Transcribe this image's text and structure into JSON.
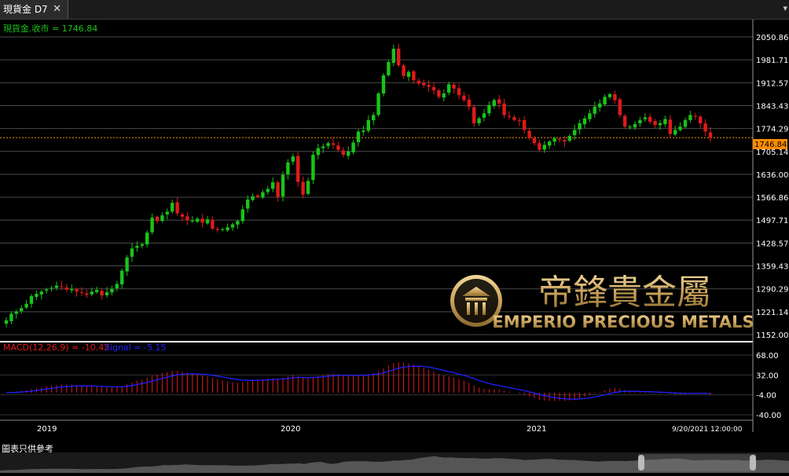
{
  "tab": {
    "title": "現貨金 D7",
    "close": "✕"
  },
  "menu_icon": "triangle-down-icon",
  "footer_note": "圖表只供參考",
  "colors": {
    "up": "#19c419",
    "down": "#e01a1a",
    "signal": "#2020ff",
    "price_line": "#ff8c00",
    "macd_hist": "#e01a1a"
  },
  "watermark": {
    "en": "EMPERIO PRECIOUS METALS",
    "zh": "帝鋒貴金屬"
  },
  "chart_data": [
    {
      "type": "candlestick",
      "label": "現貨金.收市 = 1746.84",
      "last_value": 1746.84,
      "last_label": "1746.84",
      "y_ticks": [
        "2050.86",
        "1981.71",
        "1912.57",
        "1843.43",
        "1774.29",
        "1705.14",
        "1636.00",
        "1566.86",
        "1497.71",
        "1428.57",
        "1359.43",
        "1290.29",
        "1221.14",
        "1152.00"
      ],
      "ylim": [
        1152.0,
        2050.86
      ],
      "x_tick_labels": [
        "2019",
        "2020",
        "2021"
      ],
      "x_date_label": "9/20/2021 12:00:00",
      "close_series": [
        1195,
        1215,
        1222,
        1232,
        1245,
        1268,
        1275,
        1282,
        1288,
        1293,
        1300,
        1296,
        1288,
        1290,
        1282,
        1278,
        1272,
        1282,
        1287,
        1270,
        1280,
        1290,
        1305,
        1345,
        1385,
        1412,
        1420,
        1425,
        1460,
        1505,
        1495,
        1512,
        1523,
        1550,
        1518,
        1508,
        1497,
        1496,
        1502,
        1490,
        1500,
        1472,
        1468,
        1470,
        1476,
        1485,
        1495,
        1530,
        1560,
        1570,
        1568,
        1582,
        1592,
        1612,
        1568,
        1635,
        1672,
        1690,
        1613,
        1575,
        1616,
        1695,
        1715,
        1720,
        1730,
        1725,
        1710,
        1695,
        1705,
        1732,
        1765,
        1768,
        1800,
        1815,
        1880,
        1935,
        1975,
        2015,
        1965,
        1933,
        1945,
        1920,
        1910,
        1905,
        1900,
        1890,
        1870,
        1880,
        1908,
        1895,
        1875,
        1860,
        1840,
        1790,
        1805,
        1820,
        1845,
        1860,
        1850,
        1815,
        1810,
        1800,
        1798,
        1770,
        1745,
        1730,
        1710,
        1725,
        1735,
        1745,
        1740,
        1735,
        1752,
        1770,
        1790,
        1805,
        1820,
        1840,
        1850,
        1870,
        1878,
        1860,
        1815,
        1780,
        1780,
        1788,
        1800,
        1808,
        1795,
        1785,
        1790,
        1803,
        1758,
        1770,
        1780,
        1800,
        1815,
        1810,
        1790,
        1765,
        1746.84
      ]
    },
    {
      "type": "macd",
      "label": "MACD(12,26,9) = -10.42",
      "signal_label": "Signal = -5.15",
      "macd_value": -10.42,
      "signal_value": -5.15,
      "y_ticks": [
        "68.00",
        "32.00",
        "-4.00",
        "-40.00"
      ],
      "ylim": [
        -40.0,
        68.0
      ]
    }
  ]
}
